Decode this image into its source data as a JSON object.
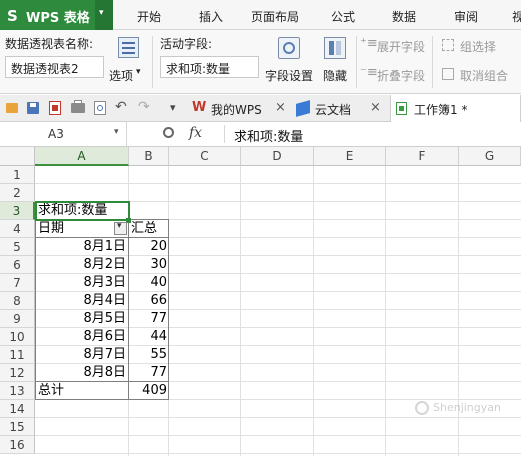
{
  "app": {
    "logo": "S",
    "title": "WPS 表格",
    "menu_arrow": "▾"
  },
  "menu_tabs": [
    "开始",
    "插入",
    "页面布局",
    "公式",
    "数据",
    "审阅",
    "视"
  ],
  "ribbon": {
    "pivot_name_label": "数据透视表名称:",
    "pivot_name_value": "数据透视表2",
    "options_label": "选项",
    "options_arrow": "▾",
    "active_field_label": "活动字段:",
    "active_field_value": "求和项:数量",
    "field_settings": "字段设置",
    "hide": "隐藏",
    "expand_field": "展开字段",
    "collapse_field": "折叠字段",
    "group_selection": "组选择",
    "ungroup": "取消组合"
  },
  "tabs": {
    "more_arrow": "▾",
    "mywps": "我的WPS",
    "cloud_docs": "云文档",
    "workbook": "工作簿1 *",
    "close": "×"
  },
  "formula_bar": {
    "cell_ref": "A3",
    "dropdown_arrow": "▾",
    "zoom_glyph": "🔍",
    "fx": "fx",
    "content": "求和项:数量"
  },
  "sheet": {
    "columns": [
      "A",
      "B",
      "C",
      "D",
      "E",
      "F",
      "G"
    ],
    "rows": [
      "1",
      "2",
      "3",
      "4",
      "5",
      "6",
      "7",
      "8",
      "9",
      "10",
      "11",
      "12",
      "13",
      "14",
      "15",
      "16"
    ],
    "selected_cell": "A3",
    "pivot_title": "求和项:数量",
    "header_date": "日期",
    "header_total": "汇总",
    "filter_arrow": "▾",
    "data": [
      {
        "date": "8月1日",
        "value": "20"
      },
      {
        "date": "8月2日",
        "value": "30"
      },
      {
        "date": "8月3日",
        "value": "40"
      },
      {
        "date": "8月4日",
        "value": "66"
      },
      {
        "date": "8月5日",
        "value": "77"
      },
      {
        "date": "8月6日",
        "value": "44"
      },
      {
        "date": "8月7日",
        "value": "55"
      },
      {
        "date": "8月8日",
        "value": "77"
      }
    ],
    "total_label": "总计",
    "total_value": "409"
  },
  "watermark": "Shenjingyan"
}
